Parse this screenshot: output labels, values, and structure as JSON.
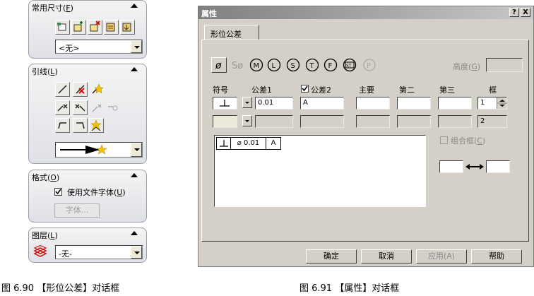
{
  "left_panel": {
    "sizes": {
      "title": "常用尺寸(",
      "title_key": "F",
      "title_end": ")",
      "combo_value": "<无>"
    },
    "leader": {
      "title": "引线(",
      "title_key": "L",
      "title_end": ")"
    },
    "format": {
      "title": "格式(",
      "title_key": "O",
      "title_end": ")",
      "checkbox_label": "使用文件字体(",
      "checkbox_key": "U",
      "checkbox_end": ")",
      "checked": true,
      "font_button": "字体..."
    },
    "layer": {
      "title": "图层(",
      "title_key": "L",
      "title_end": ")",
      "combo_value": "-无-"
    }
  },
  "dialog": {
    "title": "属性",
    "help_btn": "?",
    "close_btn": "X",
    "tab": "形位公差",
    "height_label": "高度(",
    "height_key": "G",
    "height_end": ")",
    "columns": {
      "symbol": "符号",
      "tol1": "公差1",
      "tol2": "公差2",
      "primary": "主要",
      "second": "第二",
      "third": "第三",
      "frame": "框"
    },
    "row1": {
      "tol1": "0.01",
      "tol2": "A",
      "frame": "1"
    },
    "row2": {
      "frame": "2"
    },
    "combine_label": "组合框(",
    "combine_key": "C",
    "combine_end": ")",
    "preview": {
      "value": "⌀ 0.01",
      "datum": "A"
    },
    "buttons": {
      "ok": "确定",
      "cancel": "取消",
      "apply": "应用(A)",
      "help": "帮助"
    }
  },
  "captions": {
    "left": "图 6.90  【形位公差】对话框",
    "right": "图 6.91  【属性】对话框"
  }
}
